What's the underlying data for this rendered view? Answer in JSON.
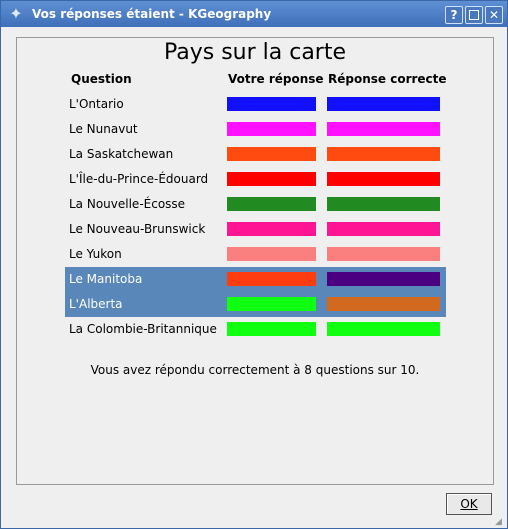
{
  "window": {
    "title": "Vos réponses étaient - KGeography",
    "buttons": {
      "help": "?",
      "close": "✕"
    }
  },
  "heading": "Pays sur la carte",
  "columns": {
    "question": "Question",
    "your_answer": "Votre réponse",
    "correct_answer": "Réponse correcte"
  },
  "rows": [
    {
      "label": "L'Ontario",
      "your_color": "#1010ff",
      "correct_color": "#1010ff",
      "selected": false
    },
    {
      "label": "Le Nunavut",
      "your_color": "#ff10ff",
      "correct_color": "#ff10ff",
      "selected": false
    },
    {
      "label": "La Saskatchewan",
      "your_color": "#ff4a10",
      "correct_color": "#ff4a10",
      "selected": false
    },
    {
      "label": "L'Île-du-Prince-Édouard",
      "your_color": "#ff0000",
      "correct_color": "#ff0000",
      "selected": false
    },
    {
      "label": "La Nouvelle-Écosse",
      "your_color": "#218b21",
      "correct_color": "#218b21",
      "selected": false
    },
    {
      "label": "Le Nouveau-Brunswick",
      "your_color": "#ff1493",
      "correct_color": "#ff1493",
      "selected": false
    },
    {
      "label": "Le Yukon",
      "your_color": "#fa8080",
      "correct_color": "#fa8080",
      "selected": false
    },
    {
      "label": "Le Manitoba",
      "your_color": "#ff3c10",
      "correct_color": "#4b0082",
      "selected": true
    },
    {
      "label": "L'Alberta",
      "your_color": "#10ff10",
      "correct_color": "#d2691e",
      "selected": true
    },
    {
      "label": "La Colombie-Britannique",
      "your_color": "#10ff10",
      "correct_color": "#10ff10",
      "selected": false
    }
  ],
  "summary": "Vous avez répondu correctement à 8 questions sur 10.",
  "ok_button": "OK",
  "colors": {
    "titlebar": "#4a7bc4",
    "selection": "#5a87ba"
  }
}
